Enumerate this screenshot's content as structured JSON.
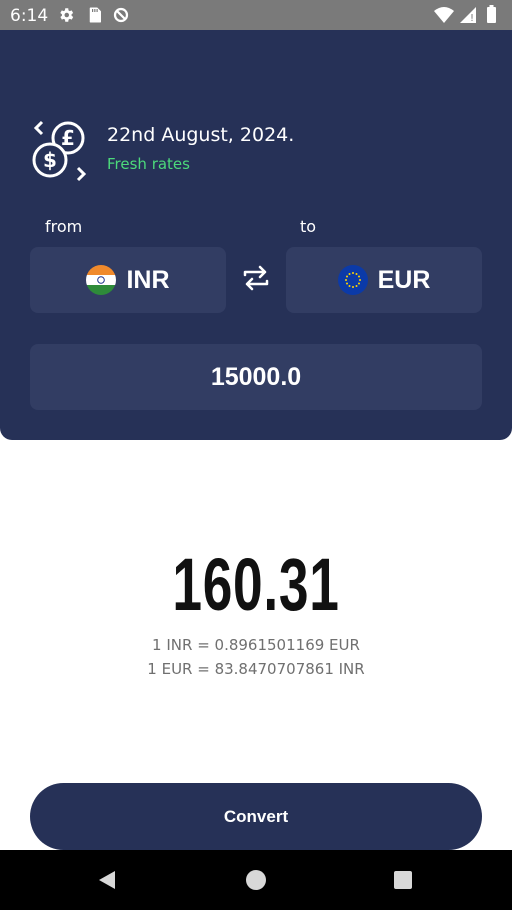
{
  "status_bar": {
    "time": "6:14",
    "icons": [
      "gear-icon",
      "sd-card-icon",
      "data-saver-icon",
      "wifi-icon",
      "cell-signal-icon",
      "battery-icon"
    ]
  },
  "header": {
    "date": "22nd August, 2024.",
    "freshness": "Fresh rates",
    "freshness_color": "#4cd97b",
    "background_color": "#263157"
  },
  "converter": {
    "from_label": "from",
    "to_label": "to",
    "from_currency": {
      "code": "INR",
      "flag": "india-flag-icon"
    },
    "to_currency": {
      "code": "EUR",
      "flag": "eu-flag-icon"
    },
    "amount": "15000.0"
  },
  "result": {
    "value": "160.31",
    "rate_forward": "1 INR = 0.8961501169 EUR",
    "rate_reverse": "1 EUR = 83.8470707861 INR"
  },
  "actions": {
    "convert_label": "Convert"
  },
  "nav_bar": {
    "buttons": [
      "back-icon",
      "home-icon",
      "recents-icon"
    ]
  }
}
